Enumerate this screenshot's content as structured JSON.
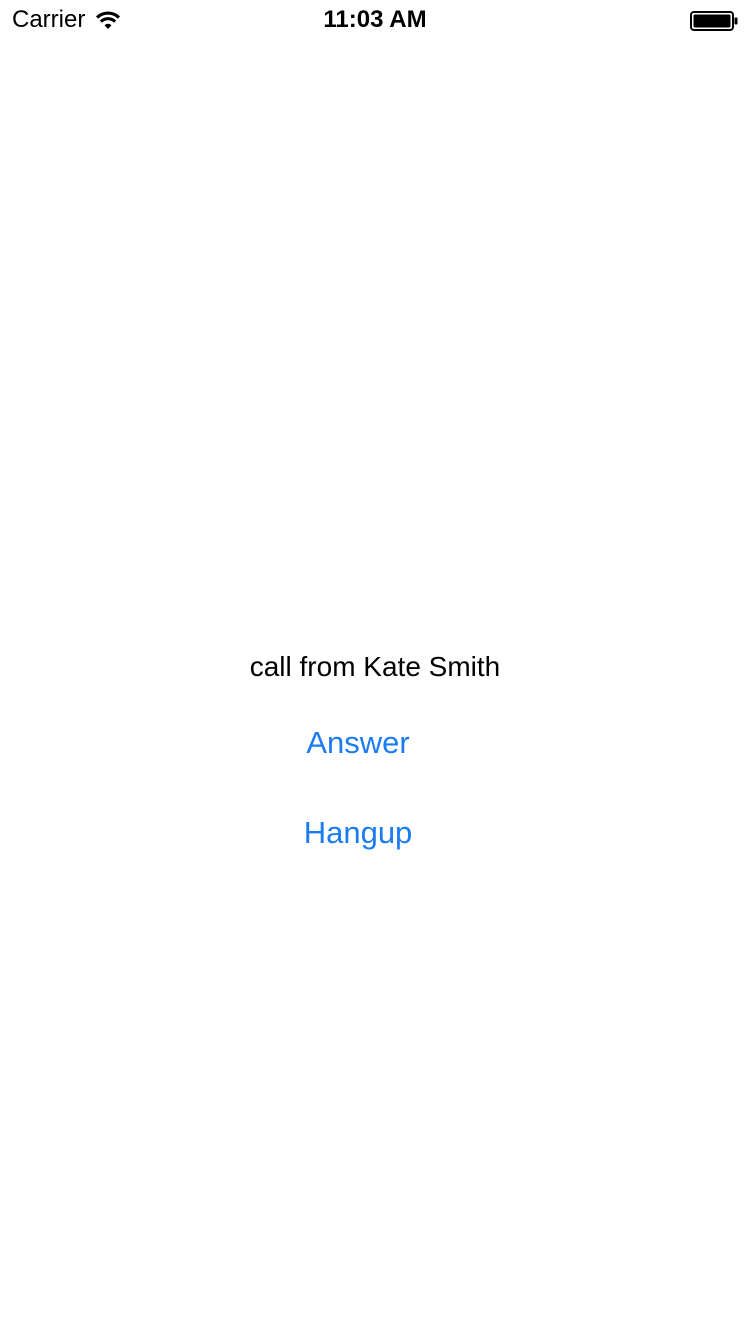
{
  "status_bar": {
    "carrier": "Carrier",
    "time": "11:03 AM",
    "wifi_icon": "wifi-icon",
    "battery_icon": "battery-icon"
  },
  "call": {
    "label": "call from Kate Smith"
  },
  "buttons": {
    "answer_label": "Answer",
    "hangup_label": "Hangup"
  },
  "colors": {
    "accent": "#1a7cf0",
    "text": "#000000",
    "background": "#ffffff"
  }
}
